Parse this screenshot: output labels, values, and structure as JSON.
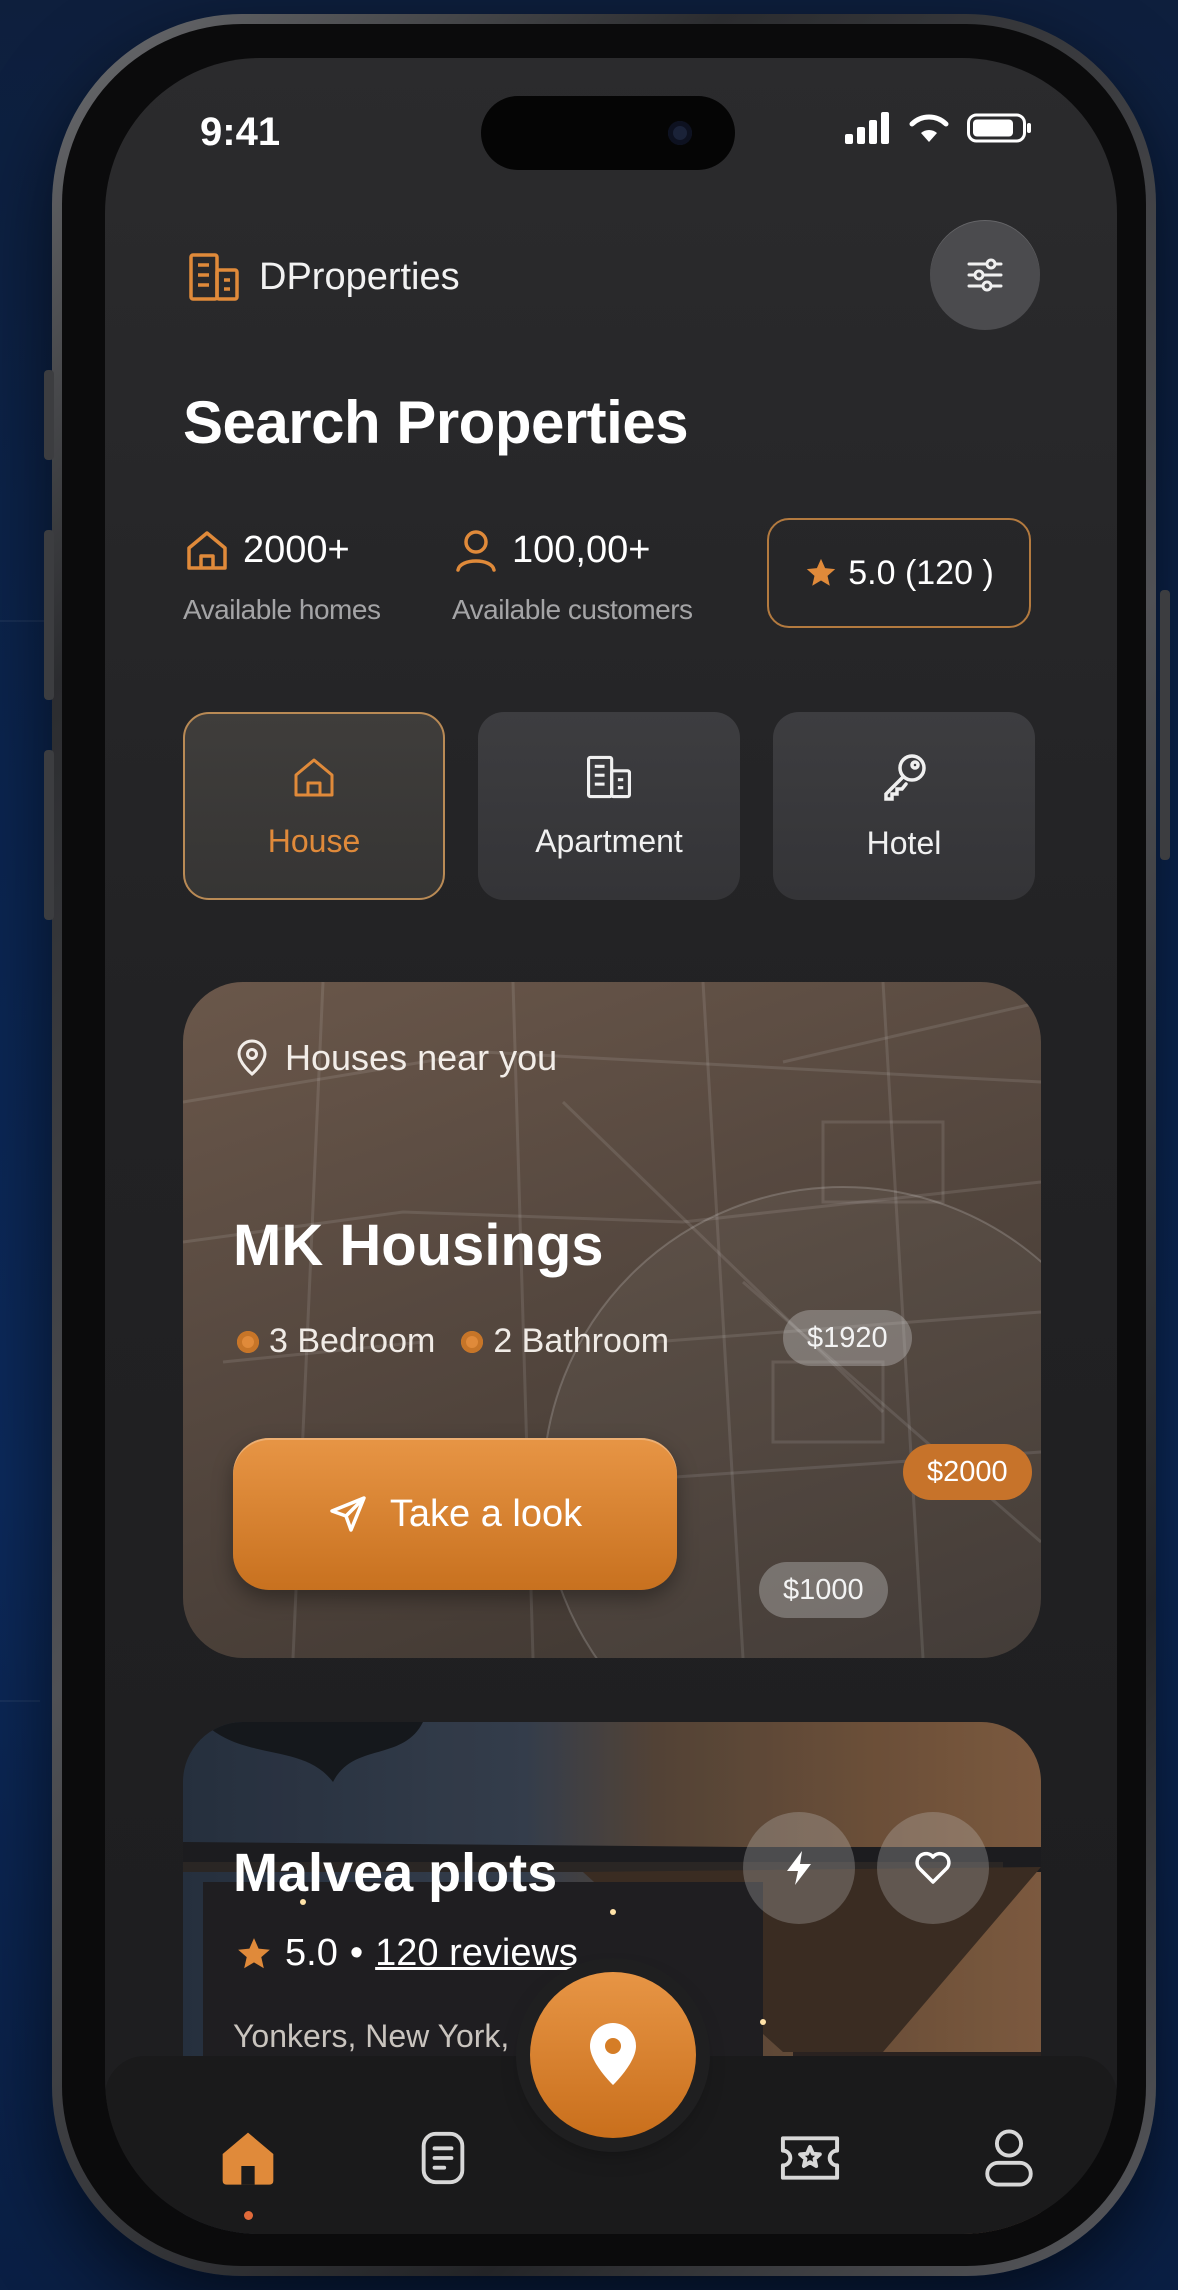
{
  "status": {
    "time": "9:41"
  },
  "header": {
    "brand": "DProperties",
    "filter_icon": "sliders-icon"
  },
  "page_title": "Search Properties",
  "stats": [
    {
      "icon": "home-icon",
      "value": "2000+",
      "label": "Available homes"
    },
    {
      "icon": "user-icon",
      "value": "100,00+",
      "label": "Available customers"
    }
  ],
  "rating": {
    "text": "5.0 (120 )"
  },
  "categories": [
    {
      "label": "House",
      "icon": "home-icon",
      "active": true
    },
    {
      "label": "Apartment",
      "icon": "building-icon",
      "active": false
    },
    {
      "label": "Hotel",
      "icon": "key-icon",
      "active": false
    }
  ],
  "featured": {
    "near_label": "Houses near you",
    "name": "MK Housings",
    "bedrooms": "3 Bedroom",
    "bathrooms": "2 Bathroom",
    "cta": "Take a look",
    "prices": [
      "$1920",
      "$2000",
      "$1000"
    ]
  },
  "listing": {
    "name": "Malvea plots",
    "rating": "5.0",
    "separator": "•",
    "reviews": "120 reviews",
    "location": "Yonkers, New York,"
  },
  "colors": {
    "accent": "#e08a3a",
    "screen_bg": "#222224",
    "blue_bg": "#0b2550"
  }
}
